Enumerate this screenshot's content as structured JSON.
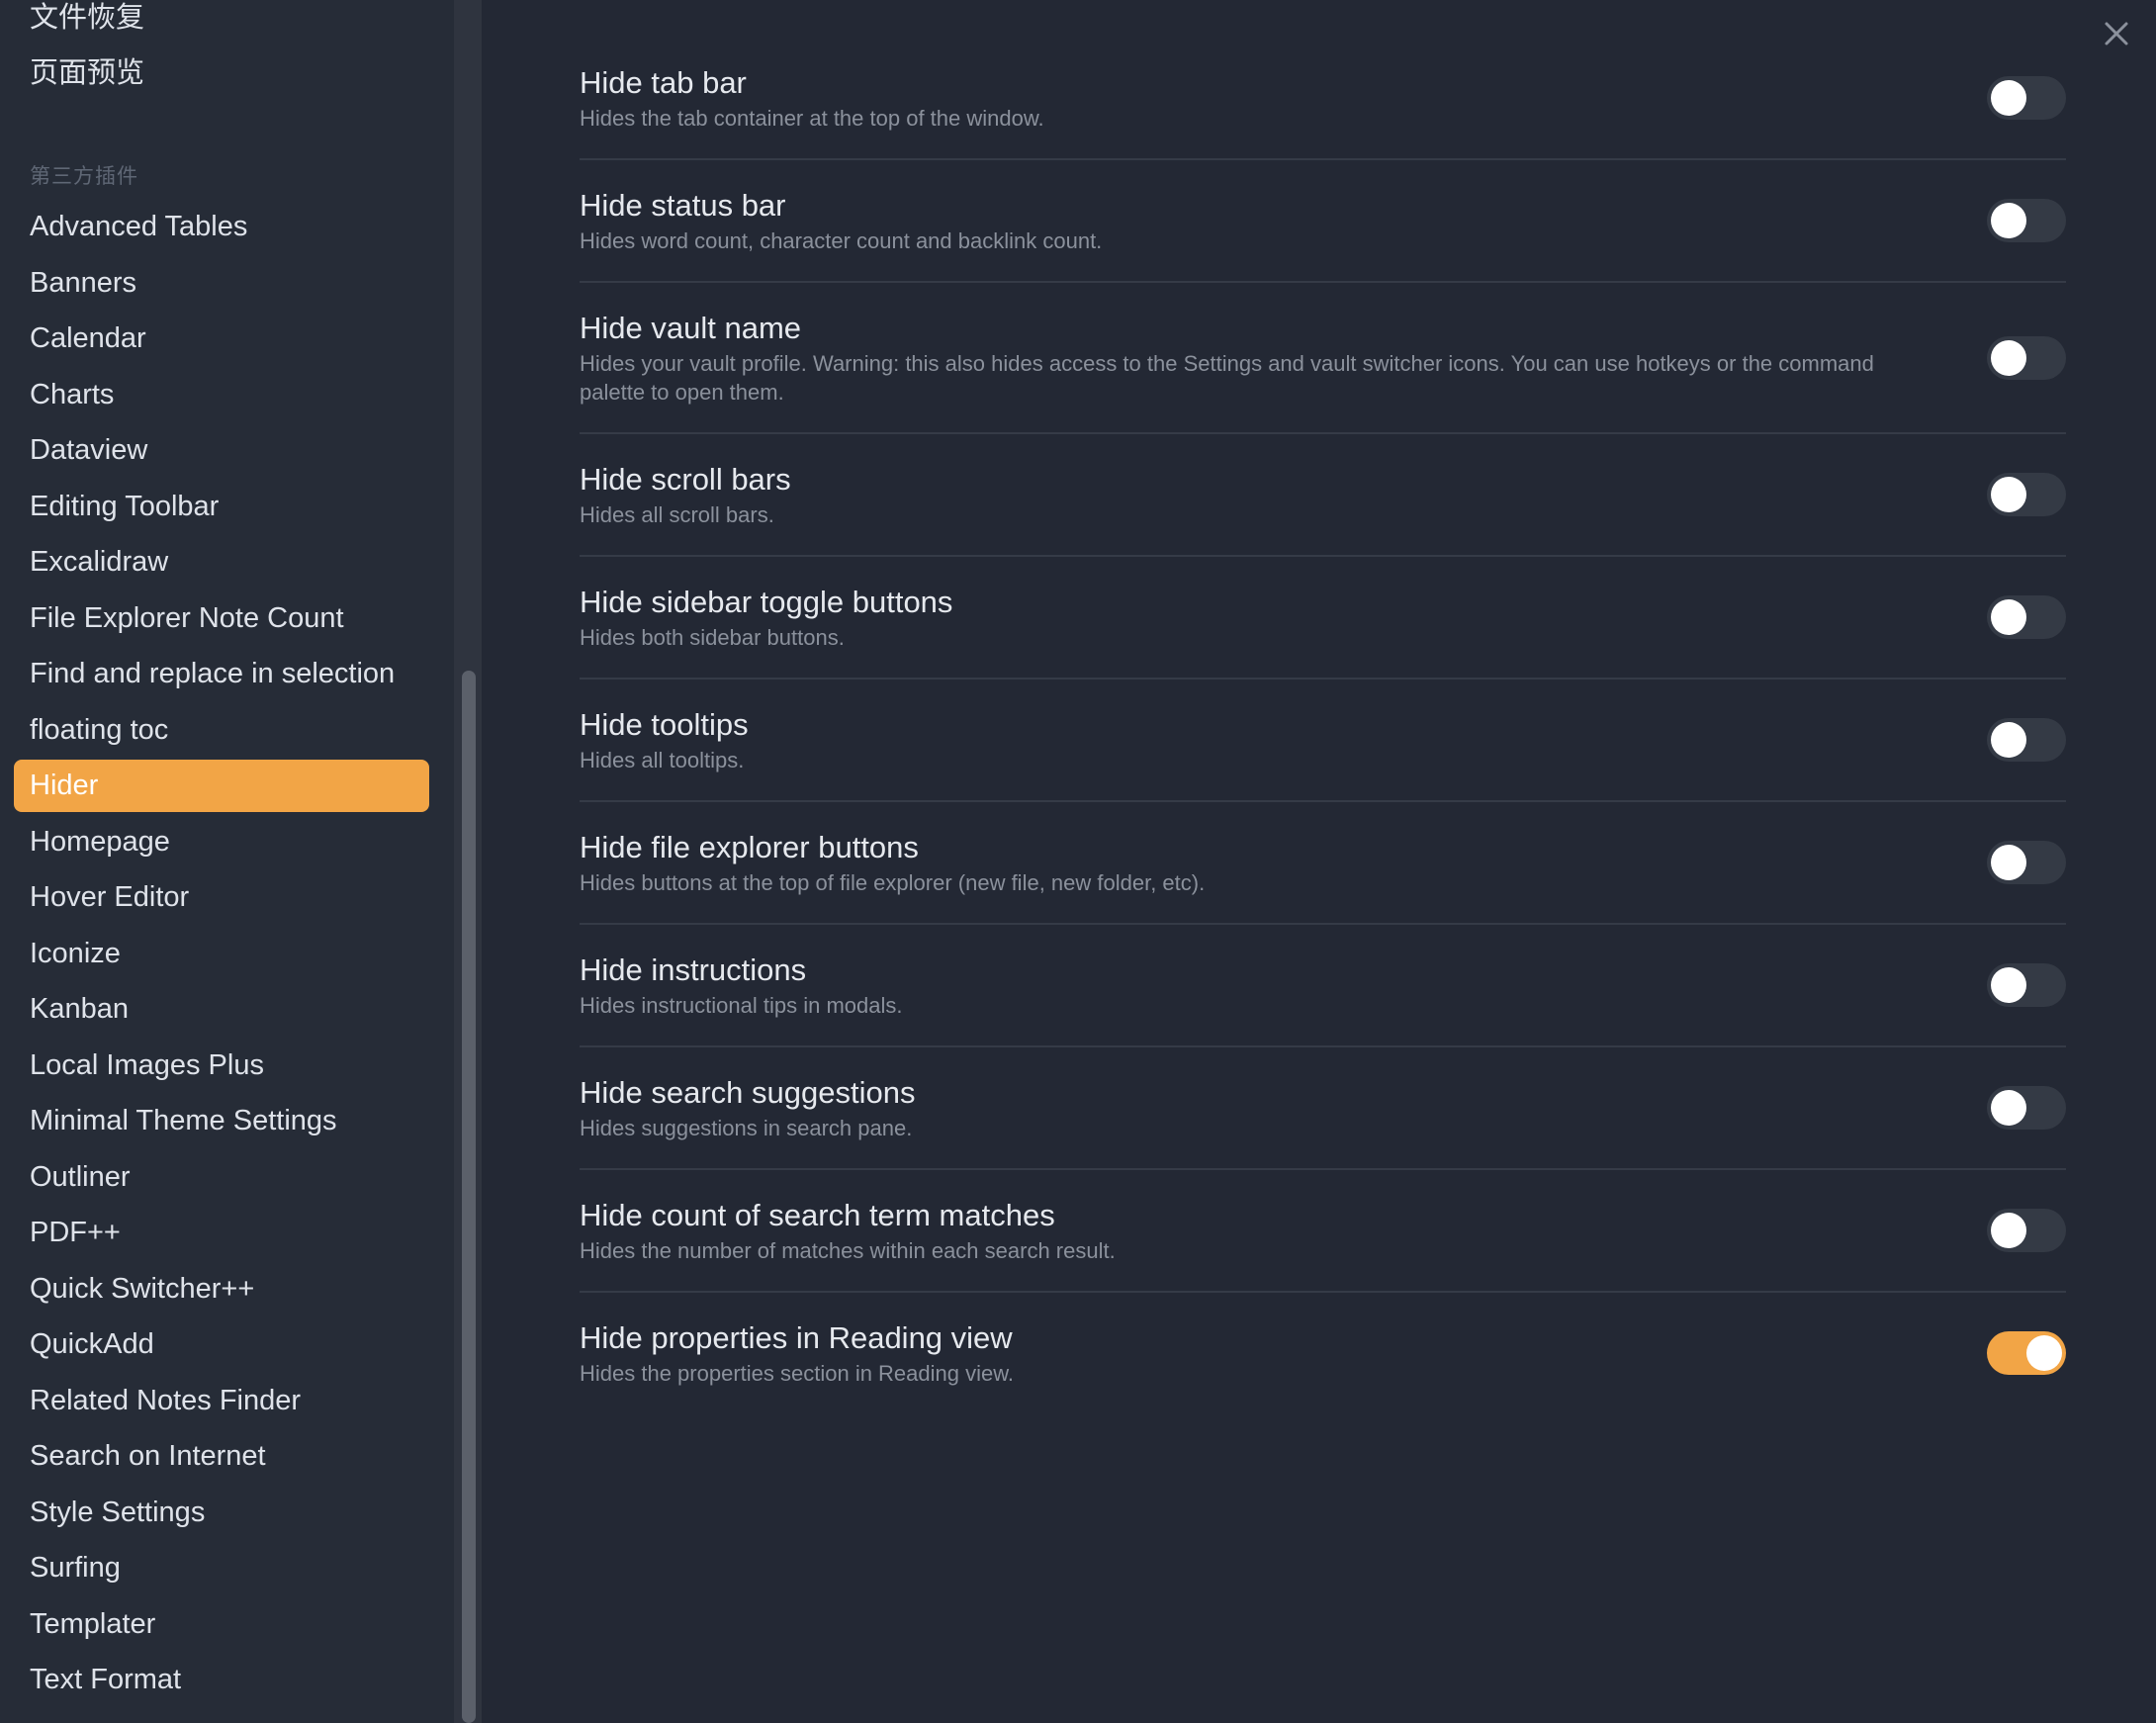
{
  "sidebar": {
    "core_items": [
      {
        "label": "文件恢复"
      },
      {
        "label": "页面预览"
      }
    ],
    "section_heading": "第三方插件",
    "plugins": [
      {
        "label": "Advanced Tables",
        "active": false
      },
      {
        "label": "Banners",
        "active": false
      },
      {
        "label": "Calendar",
        "active": false
      },
      {
        "label": "Charts",
        "active": false
      },
      {
        "label": "Dataview",
        "active": false
      },
      {
        "label": "Editing Toolbar",
        "active": false
      },
      {
        "label": "Excalidraw",
        "active": false
      },
      {
        "label": "File Explorer Note Count",
        "active": false
      },
      {
        "label": "Find and replace in selection",
        "active": false
      },
      {
        "label": "floating toc",
        "active": false
      },
      {
        "label": "Hider",
        "active": true
      },
      {
        "label": "Homepage",
        "active": false
      },
      {
        "label": "Hover Editor",
        "active": false
      },
      {
        "label": "Iconize",
        "active": false
      },
      {
        "label": "Kanban",
        "active": false
      },
      {
        "label": "Local Images Plus",
        "active": false
      },
      {
        "label": "Minimal Theme Settings",
        "active": false
      },
      {
        "label": "Outliner",
        "active": false
      },
      {
        "label": "PDF++",
        "active": false
      },
      {
        "label": "Quick Switcher++",
        "active": false
      },
      {
        "label": "QuickAdd",
        "active": false
      },
      {
        "label": "Related Notes Finder",
        "active": false
      },
      {
        "label": "Search on Internet",
        "active": false
      },
      {
        "label": "Style Settings",
        "active": false
      },
      {
        "label": "Surfing",
        "active": false
      },
      {
        "label": "Templater",
        "active": false
      },
      {
        "label": "Text Format",
        "active": false
      }
    ]
  },
  "main": {
    "close_icon": "close-icon",
    "settings": [
      {
        "name": "Hide tab bar",
        "description": "Hides the tab container at the top of the window.",
        "enabled": false
      },
      {
        "name": "Hide status bar",
        "description": "Hides word count, character count and backlink count.",
        "enabled": false
      },
      {
        "name": "Hide vault name",
        "description": "Hides your vault profile. Warning: this also hides access to the Settings and vault switcher icons. You can use hotkeys or the command palette to open them.",
        "enabled": false
      },
      {
        "name": "Hide scroll bars",
        "description": "Hides all scroll bars.",
        "enabled": false
      },
      {
        "name": "Hide sidebar toggle buttons",
        "description": "Hides both sidebar buttons.",
        "enabled": false
      },
      {
        "name": "Hide tooltips",
        "description": "Hides all tooltips.",
        "enabled": false
      },
      {
        "name": "Hide file explorer buttons",
        "description": "Hides buttons at the top of file explorer (new file, new folder, etc).",
        "enabled": false
      },
      {
        "name": "Hide instructions",
        "description": "Hides instructional tips in modals.",
        "enabled": false
      },
      {
        "name": "Hide search suggestions",
        "description": "Hides suggestions in search pane.",
        "enabled": false
      },
      {
        "name": "Hide count of search term matches",
        "description": "Hides the number of matches within each search result.",
        "enabled": false
      },
      {
        "name": "Hide properties in Reading view",
        "description": "Hides the properties section in Reading view.",
        "enabled": true
      }
    ]
  },
  "colors": {
    "accent": "#f2a546",
    "background": "#232834",
    "sidebar_background": "#262c37",
    "toggle_off": "#343a45"
  }
}
